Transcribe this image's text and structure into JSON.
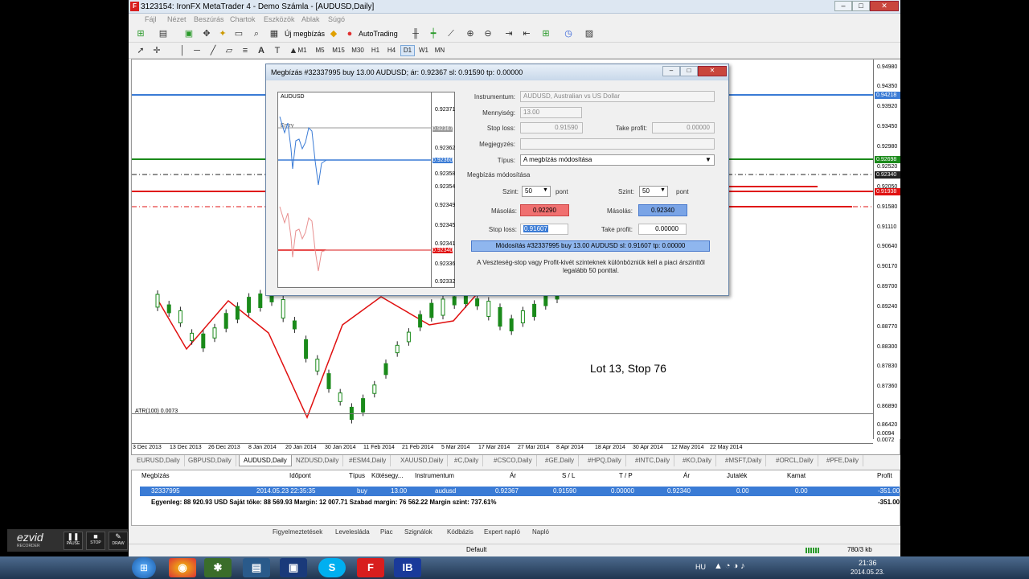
{
  "window": {
    "title": "3123154: IronFX MetaTrader 4 - Demo Számla - [AUDUSD,Daily]"
  },
  "menu": [
    "Fájl",
    "Nézet",
    "Beszúrás",
    "Chartok",
    "Eszközök",
    "Ablak",
    "Súgó"
  ],
  "toolbar": {
    "new_order": "Új megbízás",
    "autotrading": "AutoTrading"
  },
  "timeframes": [
    "M1",
    "M5",
    "M15",
    "M30",
    "H1",
    "H4",
    "D1",
    "W1",
    "MN"
  ],
  "active_timeframe": "D1",
  "chart": {
    "y_labels": [
      "0.94980",
      "0.94350",
      "0.93920",
      "0.93450",
      "0.92980",
      "0.92520",
      "0.92050",
      "0.91580",
      "0.91110",
      "0.90640",
      "0.90170",
      "0.89700",
      "0.89240",
      "0.88770",
      "0.88300",
      "0.87830",
      "0.87360",
      "0.86890",
      "0.86420"
    ],
    "price_tags": [
      {
        "value": "0.94218",
        "color": "#3a7bd5"
      },
      {
        "value": "0.92698",
        "color": "#1a8a1a"
      },
      {
        "value": "0.92340",
        "color": "#222222"
      },
      {
        "value": "0.91938",
        "color": "#e01010"
      }
    ],
    "x_labels": [
      "3 Dec 2013",
      "13 Dec 2013",
      "26 Dec 2013",
      "8 Jan 2014",
      "20 Jan 2014",
      "30 Jan 2014",
      "11 Feb 2014",
      "21 Feb 2014",
      "5 Mar 2014",
      "17 Mar 2014",
      "27 Mar 2014",
      "8 Apr 2014",
      "18 Apr 2014",
      "30 Apr 2014",
      "12 May 2014",
      "22 May 2014"
    ],
    "indicator": "ATR(100) 0.0073",
    "indicator_scale": [
      "0.0094",
      "0.0072"
    ],
    "annotation": "Lot 13, Stop 76"
  },
  "symbol_tabs": [
    "EURUSD,Daily",
    "GBPUSD,Daily",
    "AUDUSD,Daily",
    "NZDUSD,Daily",
    "#ESM4,Daily",
    "XAUUSD,Daily",
    "#C,Daily",
    "#CSCO,Daily",
    "#GE,Daily",
    "#HPQ,Daily",
    "#INTC,Daily",
    "#KO,Daily",
    "#MSFT,Daily",
    "#ORCL,Daily",
    "#PFE,Daily"
  ],
  "active_symbol_tab": "AUDUSD,Daily",
  "terminal": {
    "headers": [
      "Megbízás",
      "Időpont",
      "Típus",
      "Kötésegy...",
      "Instrumentum",
      "Ár",
      "S / L",
      "T / P",
      "Ár",
      "Jutalék",
      "Kamat",
      "Profit"
    ],
    "order": [
      "32337995",
      "2014.05.23 22:35:35",
      "buy",
      "13.00",
      "audusd",
      "0.92367",
      "0.91590",
      "0.00000",
      "0.92340",
      "0.00",
      "0.00",
      "-351.00"
    ],
    "balance": "Egyenleg: 88 920.93 USD  Saját tőke: 88 569.93  Margin: 12 007.71  Szabad margin: 76 562.22  Margin szint: 737.61%",
    "balance_profit": "-351.00",
    "tabs": [
      "Figyelmeztetések",
      "Levelesláda",
      "Piac",
      "Szignálok",
      "Kódbázis",
      "Expert napló",
      "Napló"
    ]
  },
  "status": {
    "profile": "Default",
    "traffic": "780/3 kb"
  },
  "recorder": {
    "brand": "ezvid",
    "sub": "RECORDER",
    "buttons": [
      "PAUSE",
      "STOP",
      "DRAW"
    ]
  },
  "taskbar": {
    "lang": "HU",
    "time": "21:36",
    "date": "2014.05.23."
  },
  "dialog": {
    "title": "Megbízás #32337995 buy 13.00 AUDUSD; ár: 0.92367 sl: 0.91590 tp: 0.00000",
    "mini_chart": {
      "symbol": "AUDUSD",
      "entry_label": "Entry",
      "y_labels": [
        "0.92371",
        "0.92367",
        "0.92362",
        "0.92358",
        "0.92354",
        "0.92349",
        "0.92345",
        "0.92341",
        "0.92336",
        "0.92332"
      ],
      "bid_tag": "0.92360",
      "ask_tag": "0.92340"
    },
    "instrument_label": "Instrumentum:",
    "instrument_value": "AUDUSD, Australian vs US Dollar",
    "volume_label": "Mennyiség:",
    "volume_value": "13.00",
    "sl_label": "Stop loss:",
    "sl_value": "0.91590",
    "tp_label": "Take profit:",
    "tp_value": "0.00000",
    "comment_label": "Megjegyzés:",
    "type_label": "Típus:",
    "type_value": "A megbízás módosítása",
    "section_label": "Megbízás módosítása",
    "level_label": "Szint:",
    "level_left": "50",
    "level_right": "50",
    "points": "pont",
    "copy_label": "Másolás:",
    "copy_left": "0.92290",
    "copy_right": "0.92340",
    "sl2_label": "Stop loss:",
    "sl2_value": "0.91607",
    "tp2_label": "Take profit:",
    "tp2_value": "0.00000",
    "modify_button": "Módosítás #32337995 buy 13.00 AUDUSD sl: 0.91607 tp: 0.00000",
    "note": "A Veszteség-stop  vagy Profit-kivét szinteknek különbözniük kell a piaci árszinttől legalább 50 ponttal."
  }
}
